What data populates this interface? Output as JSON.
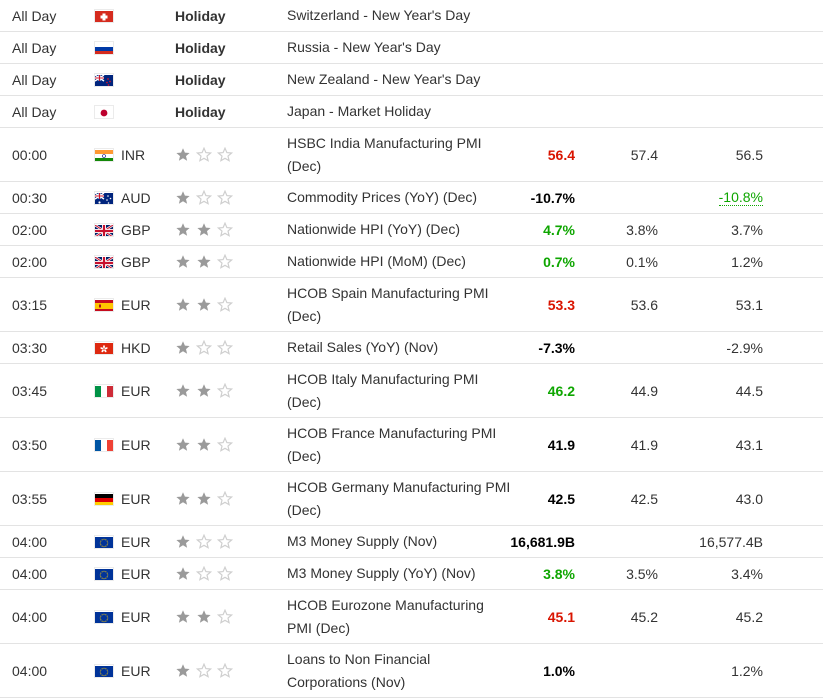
{
  "rows": [
    {
      "time": "All Day",
      "flag": "ch-flag-icon",
      "currency": "",
      "holiday": "Holiday",
      "event": "Switzerland - New Year's Day",
      "actual": "",
      "forecast": "",
      "previous": "",
      "importance": 0
    },
    {
      "time": "All Day",
      "flag": "ru-flag-icon",
      "currency": "",
      "holiday": "Holiday",
      "event": "Russia - New Year's Day",
      "actual": "",
      "forecast": "",
      "previous": "",
      "importance": 0
    },
    {
      "time": "All Day",
      "flag": "nz-flag-icon",
      "currency": "",
      "holiday": "Holiday",
      "event": "New Zealand - New Year's Day",
      "actual": "",
      "forecast": "",
      "previous": "",
      "importance": 0
    },
    {
      "time": "All Day",
      "flag": "jp-flag-icon",
      "currency": "",
      "holiday": "Holiday",
      "event": "Japan - Market Holiday",
      "actual": "",
      "forecast": "",
      "previous": "",
      "importance": 0
    },
    {
      "time": "00:00",
      "flag": "in-flag-icon",
      "currency": "INR",
      "event": "HSBC India Manufacturing PMI (Dec)",
      "actual": "56.4",
      "actual_color": "red",
      "forecast": "57.4",
      "previous": "56.5",
      "importance": 1
    },
    {
      "time": "00:30",
      "flag": "au-flag-icon",
      "currency": "AUD",
      "event": "Commodity Prices (YoY) (Dec)",
      "actual": "-10.7%",
      "actual_color": "black",
      "forecast": "",
      "previous": "-10.8%",
      "previous_revised": true,
      "importance": 1
    },
    {
      "time": "02:00",
      "flag": "gb-flag-icon",
      "currency": "GBP",
      "event": "Nationwide HPI (YoY) (Dec)",
      "actual": "4.7%",
      "actual_color": "green",
      "forecast": "3.8%",
      "previous": "3.7%",
      "importance": 2
    },
    {
      "time": "02:00",
      "flag": "gb-flag-icon",
      "currency": "GBP",
      "event": "Nationwide HPI (MoM) (Dec)",
      "actual": "0.7%",
      "actual_color": "green",
      "forecast": "0.1%",
      "previous": "1.2%",
      "importance": 2
    },
    {
      "time": "03:15",
      "flag": "es-flag-icon",
      "currency": "EUR",
      "event": "HCOB Spain Manufacturing PMI (Dec)",
      "actual": "53.3",
      "actual_color": "red",
      "forecast": "53.6",
      "previous": "53.1",
      "importance": 2
    },
    {
      "time": "03:30",
      "flag": "hk-flag-icon",
      "currency": "HKD",
      "event": "Retail Sales (YoY) (Nov)",
      "actual": "-7.3%",
      "actual_color": "black",
      "forecast": "",
      "previous": "-2.9%",
      "importance": 1
    },
    {
      "time": "03:45",
      "flag": "it-flag-icon",
      "currency": "EUR",
      "event": "HCOB Italy Manufacturing PMI (Dec)",
      "actual": "46.2",
      "actual_color": "green",
      "forecast": "44.9",
      "previous": "44.5",
      "importance": 2
    },
    {
      "time": "03:50",
      "flag": "fr-flag-icon",
      "currency": "EUR",
      "event": "HCOB France Manufacturing PMI (Dec)",
      "actual": "41.9",
      "actual_color": "black",
      "forecast": "41.9",
      "previous": "43.1",
      "importance": 2
    },
    {
      "time": "03:55",
      "flag": "de-flag-icon",
      "currency": "EUR",
      "event": "HCOB Germany Manufacturing PMI (Dec)",
      "actual": "42.5",
      "actual_color": "black",
      "forecast": "42.5",
      "previous": "43.0",
      "importance": 2
    },
    {
      "time": "04:00",
      "flag": "eu-flag-icon",
      "currency": "EUR",
      "event": "M3 Money Supply (Nov)",
      "actual": "16,681.9B",
      "actual_color": "black",
      "forecast": "",
      "previous": "16,577.4B",
      "importance": 1
    },
    {
      "time": "04:00",
      "flag": "eu-flag-icon",
      "currency": "EUR",
      "event": "M3 Money Supply (YoY) (Nov)",
      "actual": "3.8%",
      "actual_color": "green",
      "forecast": "3.5%",
      "previous": "3.4%",
      "importance": 1
    },
    {
      "time": "04:00",
      "flag": "eu-flag-icon",
      "currency": "EUR",
      "event": "HCOB Eurozone Manufacturing PMI (Dec)",
      "actual": "45.1",
      "actual_color": "red",
      "forecast": "45.2",
      "previous": "45.2",
      "importance": 2
    },
    {
      "time": "04:00",
      "flag": "eu-flag-icon",
      "currency": "EUR",
      "event": "Loans to Non Financial Corporations (Nov)",
      "actual": "1.0%",
      "actual_color": "black",
      "forecast": "",
      "previous": "1.2%",
      "importance": 1
    }
  ]
}
